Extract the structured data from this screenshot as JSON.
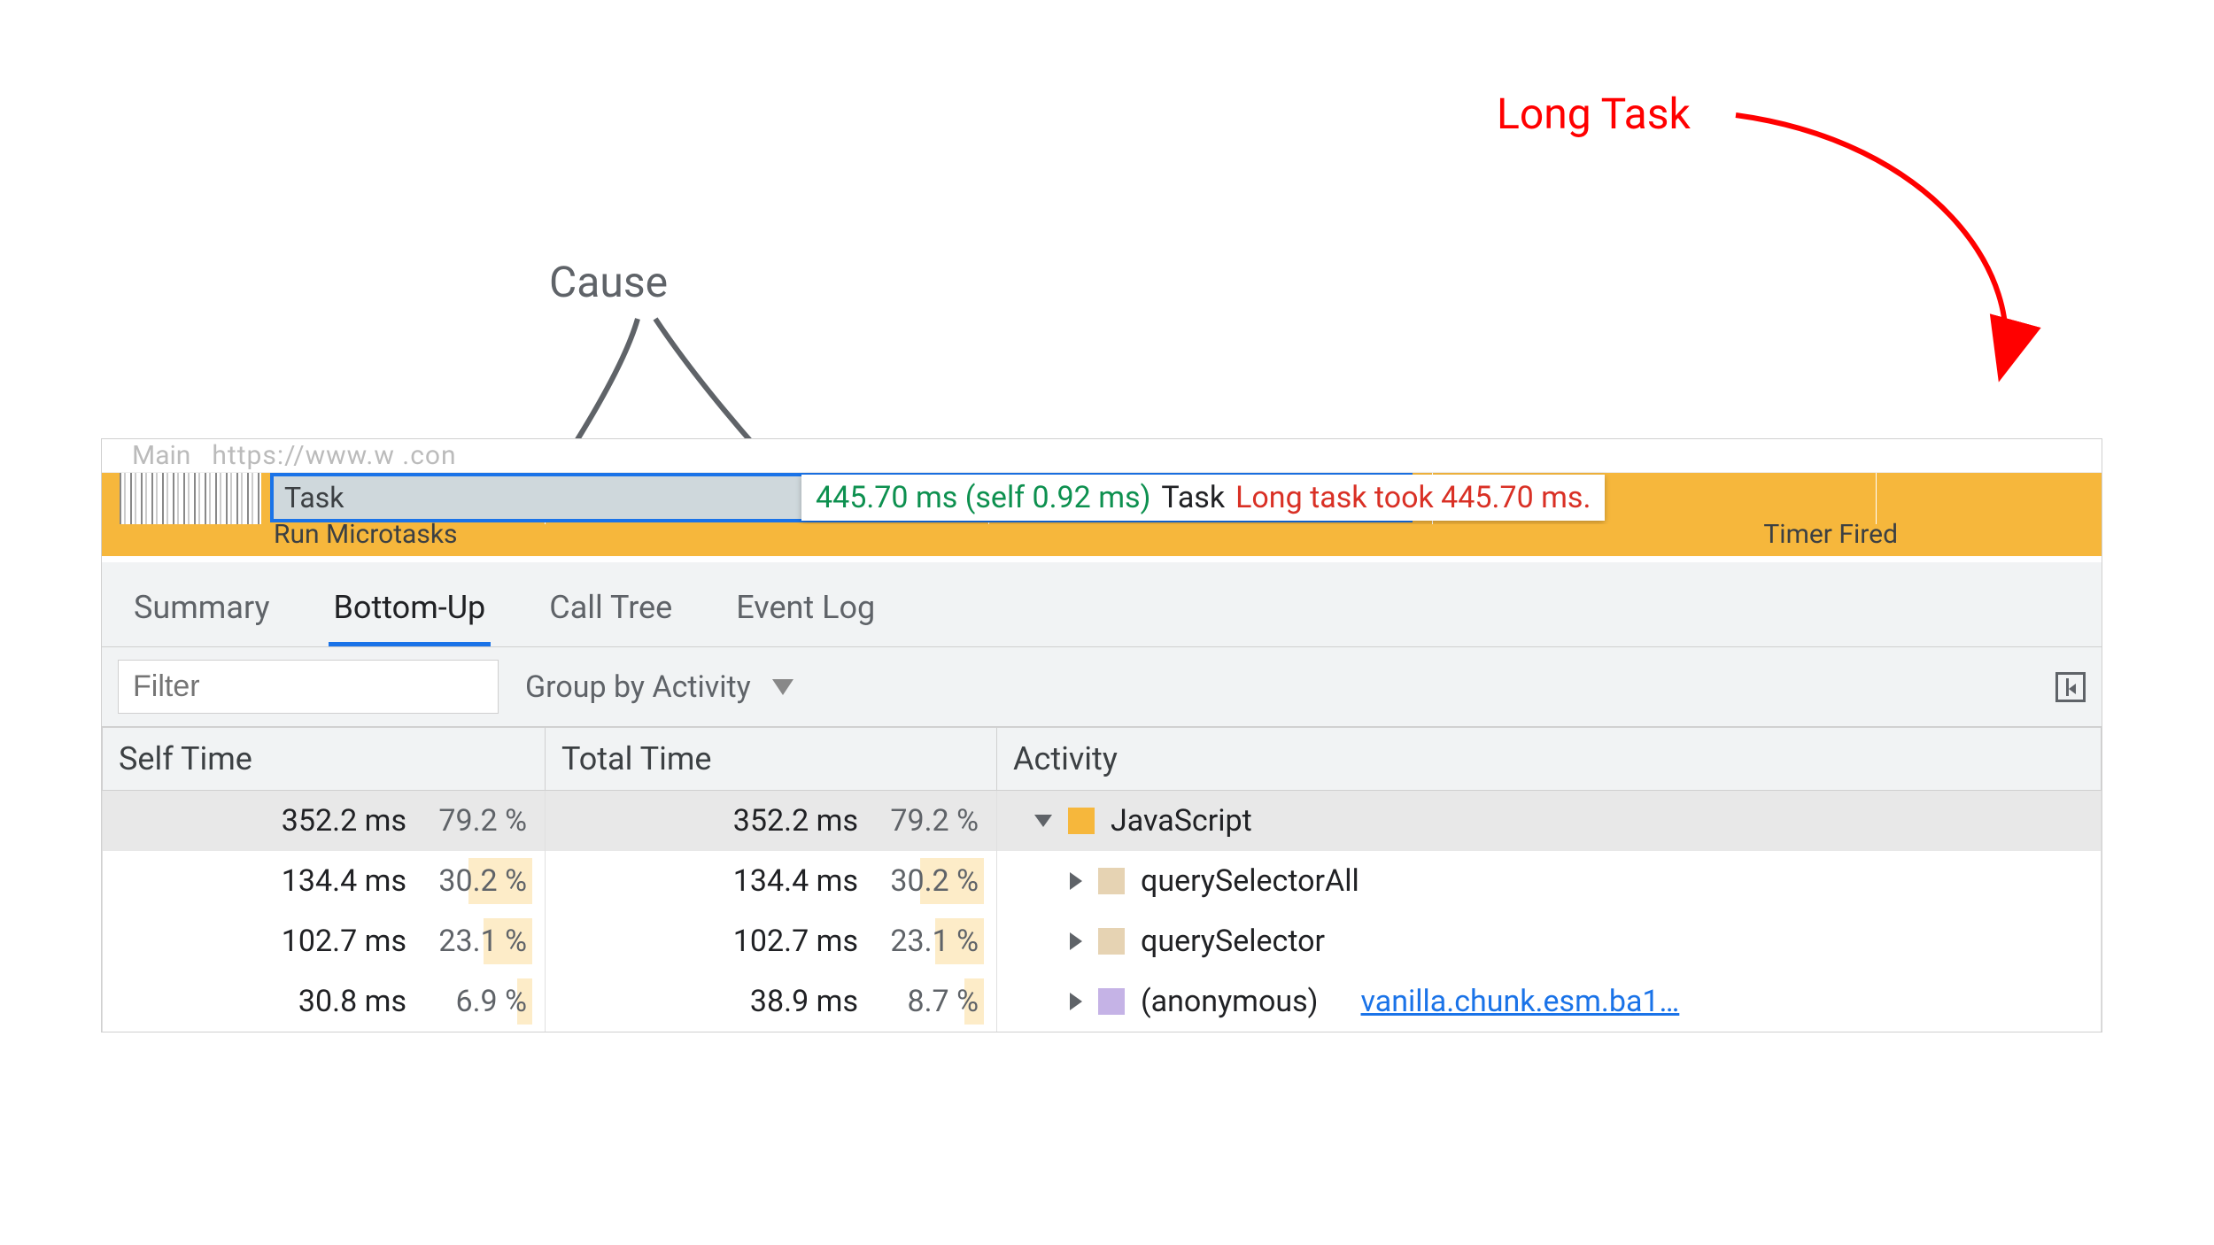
{
  "annotations": {
    "long_task": "Long Task",
    "cause": "Cause"
  },
  "flame": {
    "header_prefix": "Main",
    "header_url": "https://www.w        .con",
    "task_label": "Task",
    "tooltip_time": "445.70 ms (self 0.92 ms)",
    "tooltip_name": "Task",
    "tooltip_warn_prefix": "Long task",
    "tooltip_warn_suffix": " took 445.70 ms.",
    "microtask_label": "Run Microtasks",
    "timer_label": "Timer Fired"
  },
  "tabs": {
    "summary": "Summary",
    "bottom_up": "Bottom-Up",
    "call_tree": "Call Tree",
    "event_log": "Event Log"
  },
  "filter": {
    "placeholder": "Filter",
    "group_by": "Group by Activity"
  },
  "columns": {
    "self": "Self Time",
    "total": "Total Time",
    "activity": "Activity"
  },
  "rows": [
    {
      "self_ms": "352.2 ms",
      "self_pct": "79.2 %",
      "self_bar": 0,
      "total_ms": "352.2 ms",
      "total_pct": "79.2 %",
      "total_bar": 0,
      "indent": 0,
      "expand": "down",
      "swatch": "sw-yellow",
      "label": "JavaScript",
      "link": "",
      "hl": true
    },
    {
      "self_ms": "134.4 ms",
      "self_pct": "30.2 %",
      "self_bar": 60,
      "total_ms": "134.4 ms",
      "total_pct": "30.2 %",
      "total_bar": 60,
      "indent": 1,
      "expand": "right",
      "swatch": "sw-tan",
      "label": "querySelectorAll",
      "link": "",
      "hl": false
    },
    {
      "self_ms": "102.7 ms",
      "self_pct": "23.1 %",
      "self_bar": 46,
      "total_ms": "102.7 ms",
      "total_pct": "23.1 %",
      "total_bar": 46,
      "indent": 1,
      "expand": "right",
      "swatch": "sw-tan",
      "label": "querySelector",
      "link": "",
      "hl": false
    },
    {
      "self_ms": "30.8 ms",
      "self_pct": "6.9 %",
      "self_bar": 14,
      "total_ms": "38.9 ms",
      "total_pct": "8.7 %",
      "total_bar": 18,
      "indent": 1,
      "expand": "right",
      "swatch": "sw-purple",
      "label": "(anonymous)",
      "link": "vanilla.chunk.esm.ba1…",
      "hl": false
    }
  ]
}
